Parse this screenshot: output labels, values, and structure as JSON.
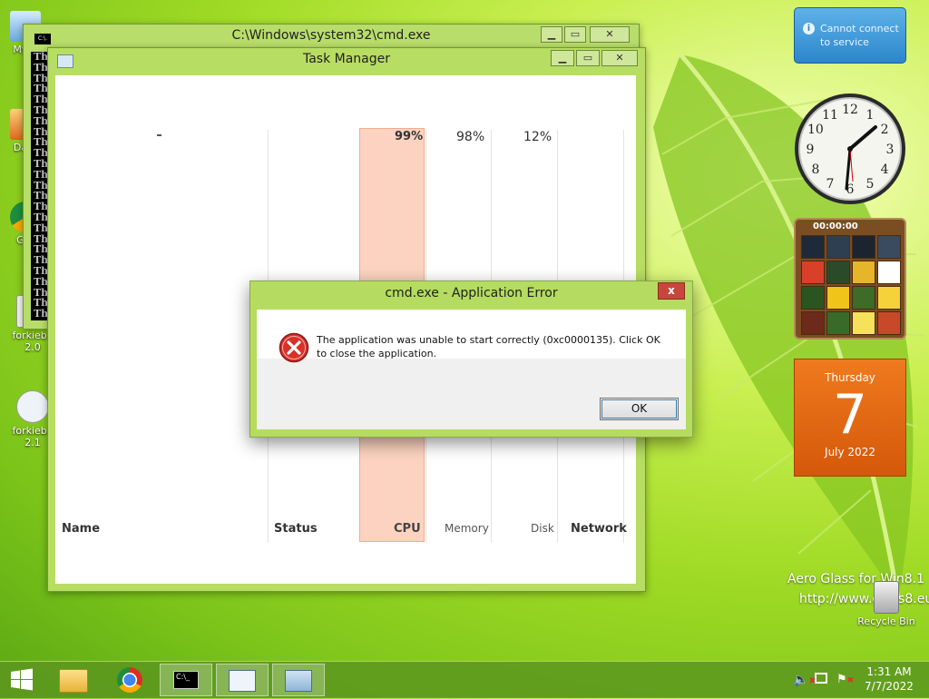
{
  "desktop": {
    "icons": [
      {
        "label": "My C"
      },
      {
        "label": "Data"
      },
      {
        "label": "G C"
      },
      {
        "label": "forkiebo 2.0"
      },
      {
        "label": "forkiebo 2.1"
      }
    ],
    "recycle_bin": "Recycle Bin",
    "watermark_line1": "Aero Glass for Win8.1",
    "watermark_line2": "http://www.glass8.eu"
  },
  "cmd_window": {
    "title": "C:\\Windows\\system32\\cmd.exe",
    "icon_text": "C:\\.",
    "lines": [
      "Th",
      "Th",
      "Th",
      "Th",
      "Th",
      "Th",
      "Th",
      "Th",
      "Th",
      "Th",
      "Th",
      "Th",
      "Th",
      "Th",
      "Th",
      "Th",
      "Th",
      "Th",
      "Th",
      "Th",
      "Th",
      "Th",
      "Th",
      "Th",
      "Th"
    ]
  },
  "task_manager": {
    "title": "Task Manager",
    "columns": {
      "name": "Name",
      "status": "Status",
      "cpu": "CPU",
      "memory": "Memory",
      "disk": "Disk",
      "network": "Network"
    },
    "usage": {
      "cpu": "99%",
      "memory": "98%",
      "disk": "12%"
    }
  },
  "error_dialog": {
    "title": "cmd.exe - Application Error",
    "close_label": "x",
    "message": "The application was unable to start correctly (0xc0000135). Click OK to close the application.",
    "ok_label": "OK",
    "icon": "error-icon"
  },
  "gadgets": {
    "toast_text": "Cannot connect to service",
    "puzzle_timer": "00:00:00",
    "calendar_day": "Thursday",
    "calendar_date": "7",
    "calendar_month": "July 2022",
    "clock_numbers": [
      "12",
      "1",
      "2",
      "3",
      "4",
      "5",
      "6",
      "7",
      "8",
      "9",
      "10",
      "11"
    ]
  },
  "taskbar": {
    "time": "1:31 AM",
    "date": "7/7/2022",
    "apps": [
      "start",
      "file-explorer",
      "chrome",
      "cmd",
      "task-manager",
      "resource-monitor"
    ]
  },
  "colors": {
    "desktop_green": "#9fda25",
    "window_frame": "#b7dd62",
    "cpu_highlight": "#fcd3c0",
    "error_red": "#c9463d",
    "calendar_orange": "#e06a12"
  }
}
